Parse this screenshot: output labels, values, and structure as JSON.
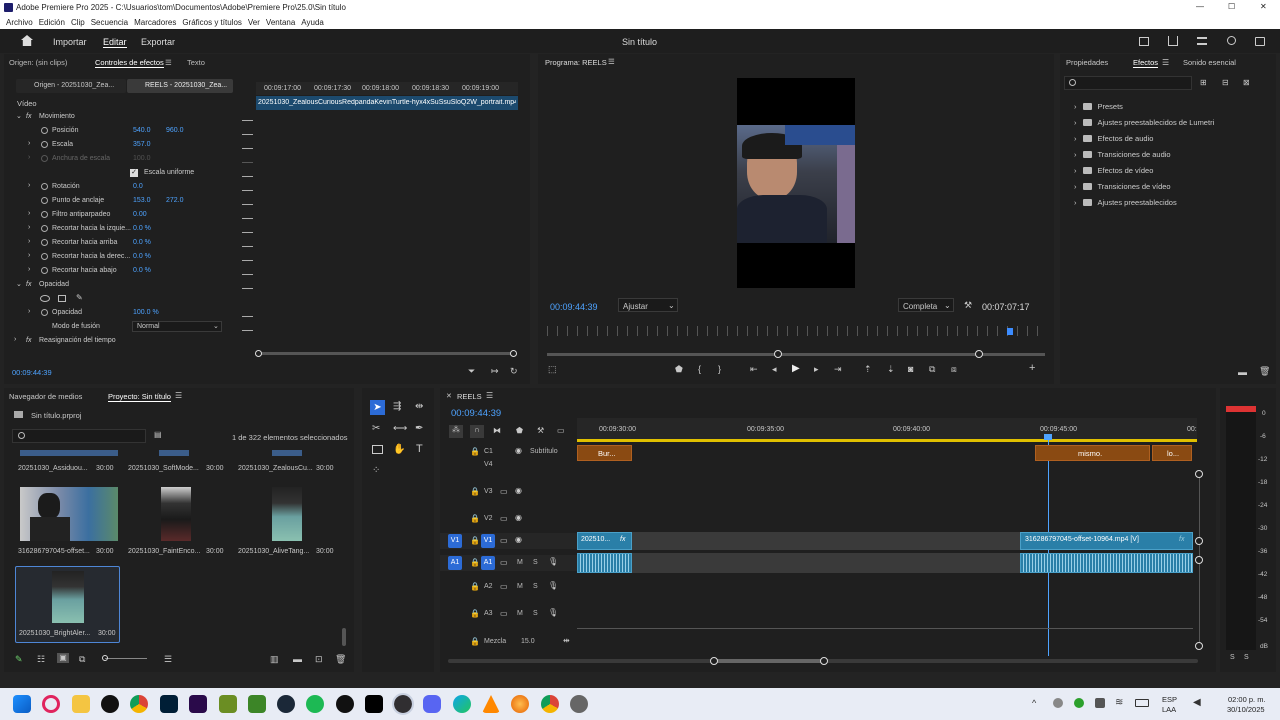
{
  "window": {
    "title": "Adobe Premiere Pro 2025 - C:\\Usuarios\\tom\\Documentos\\Adobe\\Premiere Pro\\25.0\\Sin título",
    "minimize": "—",
    "maximize": "☐",
    "close": "✕"
  },
  "menu": [
    "Archivo",
    "Edición",
    "Clip",
    "Secuencia",
    "Marcadores",
    "Gráficos y títulos",
    "Ver",
    "Ventana",
    "Ayuda"
  ],
  "header": {
    "import": "Importar",
    "edit": "Editar",
    "export": "Exportar",
    "project_title": "Sin título"
  },
  "source_panel": {
    "tabs": [
      "Origen: (sin clips)",
      "Controles de efectos",
      "Texto"
    ],
    "clip_tabs": [
      "Origen - 20251030_Zea...",
      "REELS - 20251030_Zea..."
    ],
    "ruler": [
      "00:09:17:00",
      "00:09:17:30",
      "00:09:18:00",
      "00:09:18:30",
      "00:09:19:00"
    ],
    "clip_name": "20251030_ZealousCuriousRedpandaKevinTurtle-hyx4xSuSsuSloQ2W_portrait.mp4",
    "section_video": "Vídeo",
    "timecode": "00:09:44:39"
  },
  "effect_controls": {
    "motion": "Movimiento",
    "position": {
      "label": "Posición",
      "x": "540.0",
      "y": "960.0"
    },
    "scale": {
      "label": "Escala",
      "value": "357.0"
    },
    "scale_width": {
      "label": "Anchura de escala",
      "value": "100.0"
    },
    "uniform_scale": "Escala uniforme",
    "rotation": {
      "label": "Rotación",
      "value": "0.0"
    },
    "anchor": {
      "label": "Punto de anclaje",
      "x": "153.0",
      "y": "272.0"
    },
    "antiflicker": {
      "label": "Filtro antiparpadeo",
      "value": "0.00"
    },
    "crop_left": {
      "label": "Recortar hacia la izquie...",
      "value": "0.0 %"
    },
    "crop_top": {
      "label": "Recortar hacia arriba",
      "value": "0.0 %"
    },
    "crop_right": {
      "label": "Recortar hacia la derec...",
      "value": "0.0 %"
    },
    "crop_bottom": {
      "label": "Recortar hacia abajo",
      "value": "0.0 %"
    },
    "opacity_section": "Opacidad",
    "opacity": {
      "label": "Opacidad",
      "value": "100.0 %"
    },
    "blend_mode": {
      "label": "Modo de fusión",
      "value": "Normal"
    },
    "time_remap": "Reasignación del tiempo"
  },
  "program": {
    "title": "Programa: REELS",
    "timecode": "00:09:44:39",
    "fit": "Ajustar",
    "quality": "Completa",
    "duration": "00:07:07:17"
  },
  "effects_panel": {
    "tabs": [
      "Propiedades",
      "Efectos",
      "Sonido esencial"
    ],
    "items": [
      "Presets",
      "Ajustes preestablecidos de Lumetri",
      "Efectos de audio",
      "Transiciones de audio",
      "Efectos de vídeo",
      "Transiciones de vídeo",
      "Ajustes preestablecidos"
    ]
  },
  "project_panel": {
    "tabs": [
      "Navegador de medios",
      "Proyecto: Sin título"
    ],
    "file": "Sin título.prproj",
    "selection": "1 de 322 elementos seleccionados",
    "items": [
      {
        "name": "20251030_Assiduou...",
        "dur": "30:00"
      },
      {
        "name": "20251030_SoftMode...",
        "dur": "30:00"
      },
      {
        "name": "20251030_ZealousCu...",
        "dur": "30:00"
      },
      {
        "name": "316286797045-offset...",
        "dur": "30:00"
      },
      {
        "name": "20251030_FaintEnco...",
        "dur": "30:00"
      },
      {
        "name": "20251030_AliveTang...",
        "dur": "30:00"
      },
      {
        "name": "20251030_BrightAler...",
        "dur": "30:00"
      }
    ]
  },
  "timeline": {
    "tab": "REELS",
    "timecode": "00:09:44:39",
    "ruler": [
      "00:09:30:00",
      "00:09:35:00",
      "00:09:40:00",
      "00:09:45:00",
      "00:"
    ],
    "tracks": {
      "c1": "C1",
      "subtitle": "Subtítulo",
      "v4": "V4",
      "v3": "V3",
      "v2": "V2",
      "v1": "V1",
      "a1": "A1",
      "a2": "A2",
      "a3": "A3",
      "mix": "Mezcla",
      "mix_value": "15.0"
    },
    "captions": [
      "Bur...",
      "mismo.",
      "lo..."
    ],
    "clips": {
      "v1a": "202510...",
      "v1b": "316286797045-offset-10964.mp4 [V]",
      "fx": "fx"
    },
    "ms": [
      "M",
      "S"
    ]
  },
  "meter": {
    "scale": [
      "0",
      "-6",
      "-12",
      "-18",
      "-24",
      "-30",
      "-36",
      "-42",
      "-48",
      "-54",
      "dB"
    ],
    "solo": [
      "S",
      "S"
    ]
  },
  "taskbar": {
    "lang": "ESP",
    "lang2": "LAA",
    "time": "02:00 p. m.",
    "date": "30/10/2025"
  }
}
